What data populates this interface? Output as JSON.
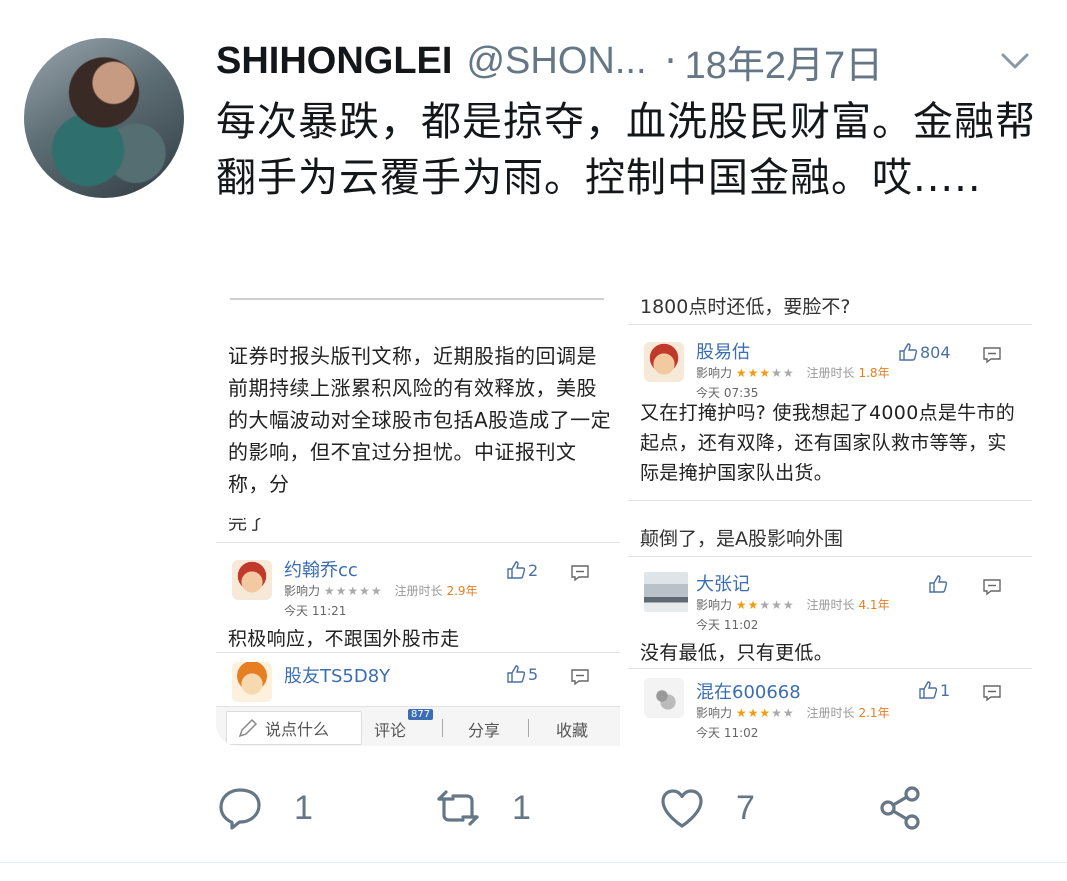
{
  "tweet": {
    "display_name": "SHIHONGLEI",
    "handle": "@SHON...",
    "separator": "·",
    "date": "18年2月7日",
    "text": "每次暴跌，都是掠夺，血洗股民财富。金融帮翻手为云覆手为雨。控制中国金融。哎....."
  },
  "images": {
    "article": {
      "text": "证券时报头版刊文称，近期股指的回调是前期持续上涨累积风险的有效释放，美股的大幅波动对全球股市包括A股造成了一定的影响，但不宜过分担忧。中证报刊文称，分"
    },
    "top_right": {
      "quote": "1800点时还低，要脸不?",
      "comment": {
        "user": "股易估",
        "influence_label": "影响力",
        "stars": "★★★",
        "stars_grey": "★★",
        "reg_label": "注册时长",
        "reg_years": "1.8年",
        "time": "今天 07:35",
        "likes": "804",
        "body": "又在打掩护吗? 使我想起了4000点是牛市的起点，还有双降，还有国家队救市等等，实际是掩护国家队出货。"
      }
    },
    "bottom_left": {
      "top_fragment": "完了",
      "comment1": {
        "user": "约翰乔cc",
        "influence_label": "影响力",
        "stars_grey": "★★★★★",
        "reg_label": "注册时长",
        "reg_years": "2.9年",
        "time": "今天 11:21",
        "likes": "2",
        "body": "积极响应，不跟国外股市走"
      },
      "comment2": {
        "user": "股友TS5D8Y",
        "likes": "5"
      },
      "bar": {
        "say": "说点什么",
        "comment": "评论",
        "comment_count": "877",
        "share": "分享",
        "favorite": "收藏"
      }
    },
    "bottom_right": {
      "quote": "颠倒了，是A股影响外围",
      "comment1": {
        "user": "大张记",
        "influence_label": "影响力",
        "stars": "★★",
        "stars_grey": "★★★",
        "reg_label": "注册时长",
        "reg_years": "4.1年",
        "time": "今天 11:02",
        "likes": "",
        "body": "没有最低，只有更低。"
      },
      "comment2": {
        "user": "混在600668",
        "influence_label": "影响力",
        "stars": "★★★",
        "stars_grey": "★★",
        "reg_label": "注册时长",
        "reg_years": "2.1年",
        "time": "今天 11:02",
        "likes": "1"
      }
    }
  },
  "actions": {
    "reply_count": "1",
    "retweet_count": "1",
    "like_count": "7"
  },
  "colors": {
    "secondary_text": "#657786",
    "link_blue": "#3b6db4",
    "star_orange": "#f39c12"
  }
}
